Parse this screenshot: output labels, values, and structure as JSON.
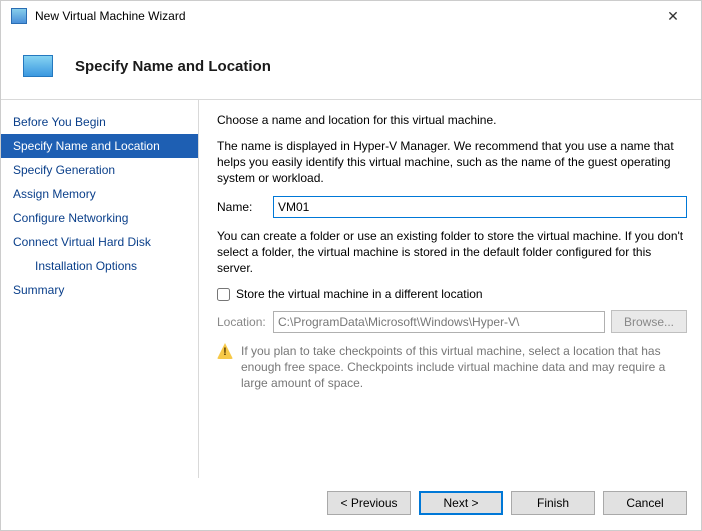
{
  "window": {
    "title": "New Virtual Machine Wizard"
  },
  "header": {
    "title": "Specify Name and Location"
  },
  "sidebar": {
    "steps": [
      {
        "label": "Before You Begin"
      },
      {
        "label": "Specify Name and Location"
      },
      {
        "label": "Specify Generation"
      },
      {
        "label": "Assign Memory"
      },
      {
        "label": "Configure Networking"
      },
      {
        "label": "Connect Virtual Hard Disk"
      },
      {
        "label": "Installation Options"
      },
      {
        "label": "Summary"
      }
    ]
  },
  "content": {
    "intro": "Choose a name and location for this virtual machine.",
    "desc": "The name is displayed in Hyper-V Manager. We recommend that you use a name that helps you easily identify this virtual machine, such as the name of the guest operating system or workload.",
    "name_label": "Name:",
    "name_value": "VM01",
    "folder_desc": "You can create a folder or use an existing folder to store the virtual machine. If you don't select a folder, the virtual machine is stored in the default folder configured for this server.",
    "store_checkbox": "Store the virtual machine in a different location",
    "location_label": "Location:",
    "location_value": "C:\\ProgramData\\Microsoft\\Windows\\Hyper-V\\",
    "browse_label": "Browse...",
    "warning": "If you plan to take checkpoints of this virtual machine, select a location that has enough free space. Checkpoints include virtual machine data and may require a large amount of space."
  },
  "footer": {
    "previous": "< Previous",
    "next": "Next >",
    "finish": "Finish",
    "cancel": "Cancel"
  }
}
